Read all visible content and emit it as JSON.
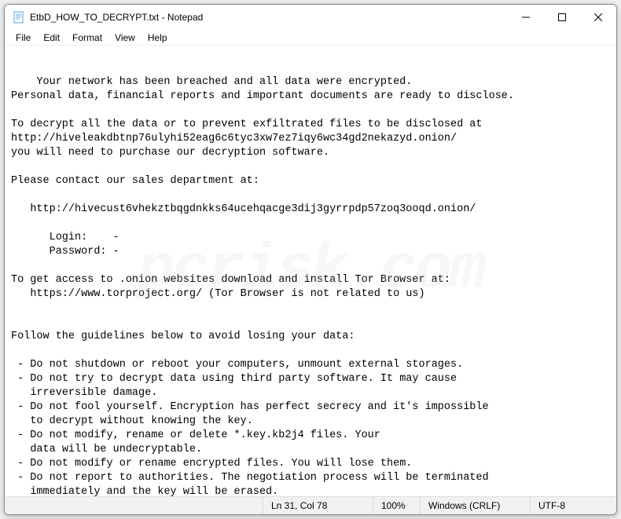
{
  "window": {
    "title": "EtbD_HOW_TO_DECRYPT.txt - Notepad"
  },
  "menu": {
    "items": [
      "File",
      "Edit",
      "Format",
      "View",
      "Help"
    ]
  },
  "content": {
    "text": "Your network has been breached and all data were encrypted.\nPersonal data, financial reports and important documents are ready to disclose.\n\nTo decrypt all the data or to prevent exfiltrated files to be disclosed at\nhttp://hiveleakdbtnp76ulyhi52eag6c6tyc3xw7ez7iqy6wc34gd2nekazyd.onion/\nyou will need to purchase our decryption software.\n\nPlease contact our sales department at:\n\n   http://hivecust6vhekztbqgdnkks64ucehqacge3dij3gyrrpdp57zoq3ooqd.onion/\n\n      Login:    -\n      Password: -\n\nTo get access to .onion websites download and install Tor Browser at:\n   https://www.torproject.org/ (Tor Browser is not related to us)\n\n\nFollow the guidelines below to avoid losing your data:\n\n - Do not shutdown or reboot your computers, unmount external storages.\n - Do not try to decrypt data using third party software. It may cause \n   irreversible damage.\n - Do not fool yourself. Encryption has perfect secrecy and it's impossible \n   to decrypt without knowing the key.\n - Do not modify, rename or delete *.key.kb2j4 files. Your \n   data will be undecryptable.\n - Do not modify or rename encrypted files. You will lose them.\n - Do not report to authorities. The negotiation process will be terminated \n   immediately and the key will be erased.\n - Do not reject to purchase. Your sensitive data will be publicly disclosed."
  },
  "statusbar": {
    "position": "Ln 31, Col 78",
    "zoom": "100%",
    "line_ending": "Windows (CRLF)",
    "encoding": "UTF-8"
  },
  "watermark": "pcrisk.com"
}
